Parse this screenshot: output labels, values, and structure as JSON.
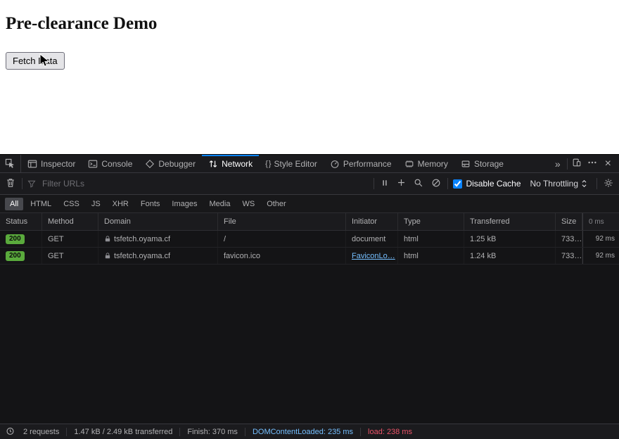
{
  "page": {
    "title": "Pre-clearance Demo",
    "fetch_button": "Fetch Data"
  },
  "devtools": {
    "tabs": [
      {
        "label": "Inspector",
        "icon": "inspector-icon"
      },
      {
        "label": "Console",
        "icon": "console-icon"
      },
      {
        "label": "Debugger",
        "icon": "debugger-icon"
      },
      {
        "label": "Network",
        "icon": "network-icon",
        "active": true
      },
      {
        "label": "Style Editor",
        "icon": "style-editor-icon"
      },
      {
        "label": "Performance",
        "icon": "performance-icon"
      },
      {
        "label": "Memory",
        "icon": "memory-icon"
      },
      {
        "label": "Storage",
        "icon": "storage-icon"
      }
    ],
    "icons": {
      "more_tabs": "»",
      "close": "×",
      "style_editor_glyph": "{ }"
    },
    "toolbar": {
      "filter_placeholder": "Filter URLs",
      "disable_cache": "Disable Cache",
      "throttling": "No Throttling"
    },
    "filters": [
      "All",
      "HTML",
      "CSS",
      "JS",
      "XHR",
      "Fonts",
      "Images",
      "Media",
      "WS",
      "Other"
    ],
    "active_filter": "All",
    "table": {
      "headers": {
        "status": "Status",
        "method": "Method",
        "domain": "Domain",
        "file": "File",
        "initiator": "Initiator",
        "type": "Type",
        "transferred": "Transferred",
        "size": "Size",
        "timeline": "0 ms"
      },
      "rows": [
        {
          "status": "200",
          "method": "GET",
          "domain": "tsfetch.oyama.cf",
          "file": "/",
          "initiator": "document",
          "type": "html",
          "transferred": "1.25 kB",
          "size": "733…",
          "time": "92 ms"
        },
        {
          "status": "200",
          "method": "GET",
          "domain": "tsfetch.oyama.cf",
          "file": "favicon.ico",
          "initiator": "FaviconLo…",
          "type": "html",
          "transferred": "1.24 kB",
          "size": "733…",
          "time": "92 ms"
        }
      ]
    },
    "statusbar": {
      "requests": "2 requests",
      "transferred": "1.47 kB / 2.49 kB transferred",
      "finish": "Finish: 370 ms",
      "domcontentloaded": "DOMContentLoaded: 235 ms",
      "load": "load: 238 ms"
    },
    "colors": {
      "accent_blue": "#0a84ff",
      "link_blue": "#75bfff",
      "status_green": "#5aaa3c",
      "load_red": "#eb5368"
    }
  }
}
